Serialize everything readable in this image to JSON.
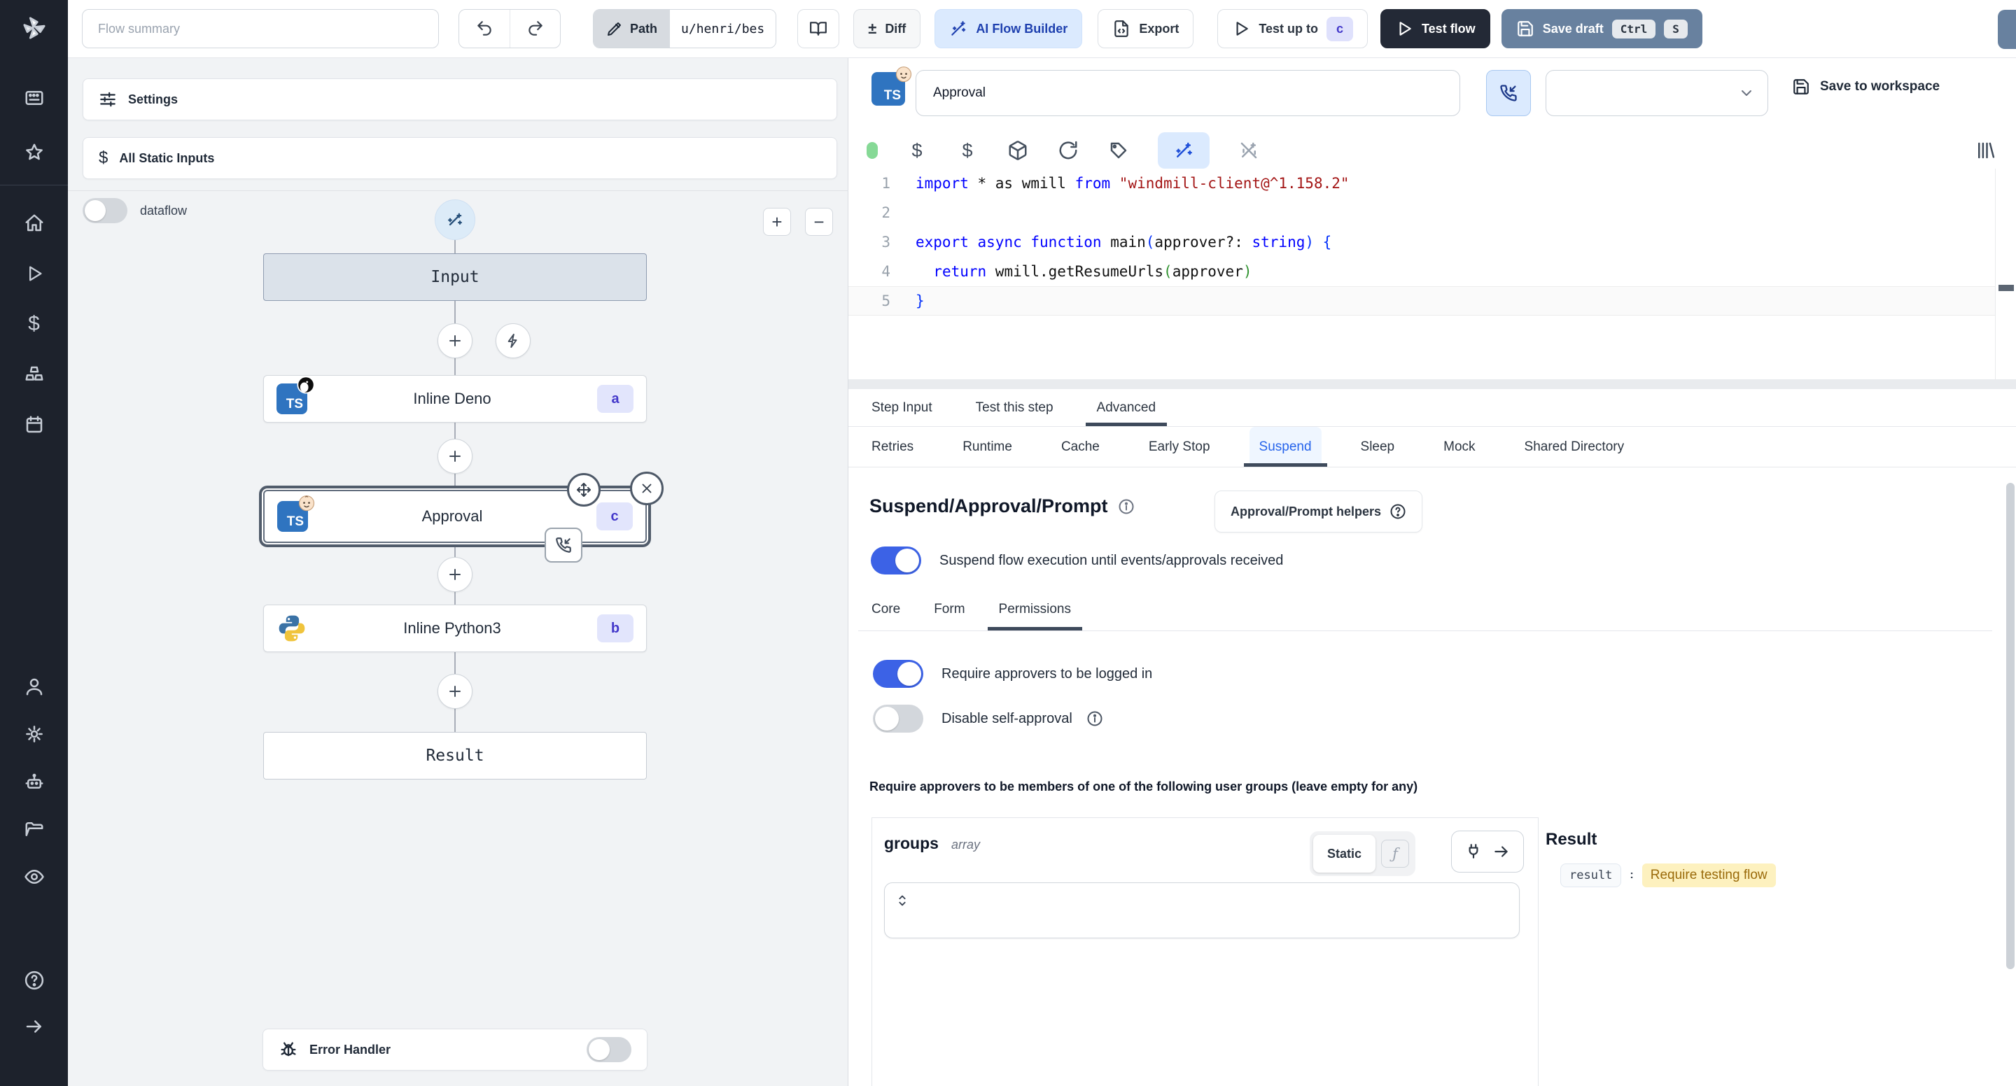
{
  "topbar": {
    "flow_summary_placeholder": "Flow summary",
    "path_label": "Path",
    "path_value": "u/henri/bes",
    "diff_label": "Diff",
    "ai_flow_builder_label": "AI Flow Builder",
    "export_label": "Export",
    "test_up_to_label": "Test up to",
    "test_up_to_badge": "c",
    "test_flow_label": "Test flow",
    "save_draft_label": "Save draft",
    "kbd_ctrl": "Ctrl",
    "kbd_s": "S"
  },
  "flow_panel": {
    "settings_label": "Settings",
    "all_static_inputs_label": "All Static Inputs",
    "dataflow_label": "dataflow",
    "error_handler_label": "Error Handler",
    "ts_chip": "TS",
    "nodes": {
      "input_label": "Input",
      "deno": {
        "label": "Inline Deno",
        "badge": "a"
      },
      "approval": {
        "label": "Approval",
        "badge": "c"
      },
      "python": {
        "label": "Inline Python3",
        "badge": "b"
      },
      "result_label": "Result"
    }
  },
  "editor": {
    "title_value": "Approval",
    "save_to_workspace_label": "Save to workspace",
    "code_lines": [
      {
        "n": "1",
        "toks": [
          [
            "kw",
            "import"
          ],
          [
            "pl",
            " * as wmill "
          ],
          [
            "kw",
            "from"
          ],
          [
            "str",
            " \"windmill-client@^1.158.2\""
          ]
        ],
        "current": false
      },
      {
        "n": "2",
        "toks": [],
        "current": false
      },
      {
        "n": "3",
        "toks": [
          [
            "kw",
            "export"
          ],
          [
            "pl",
            " "
          ],
          [
            "kw",
            "async"
          ],
          [
            "pl",
            " "
          ],
          [
            "kw",
            "function"
          ],
          [
            "pl",
            " main"
          ],
          [
            "b1",
            "("
          ],
          [
            "pl",
            "approver?: "
          ],
          [
            "kw",
            "string"
          ],
          [
            "b1",
            ")"
          ],
          [
            "pl",
            " "
          ],
          [
            "b1",
            "{"
          ]
        ],
        "current": false
      },
      {
        "n": "4",
        "toks": [
          [
            "pl",
            "  "
          ],
          [
            "kw",
            "return"
          ],
          [
            "pl",
            " wmill.getResumeUrls"
          ],
          [
            "b2",
            "("
          ],
          [
            "pl",
            "approver"
          ],
          [
            "b2",
            ")"
          ]
        ],
        "current": false
      },
      {
        "n": "5",
        "toks": [
          [
            "b1",
            "}"
          ]
        ],
        "current": true
      }
    ]
  },
  "tabs": {
    "step_input": "Step Input",
    "test_this_step": "Test this step",
    "advanced": "Advanced"
  },
  "advanced_tabs": [
    "Retries",
    "Runtime",
    "Cache",
    "Early Stop",
    "Suspend",
    "Sleep",
    "Mock",
    "Shared Directory"
  ],
  "suspend_section": {
    "heading": "Suspend/Approval/Prompt",
    "helpers_button_label": "Approval/Prompt helpers",
    "suspend_toggle_label": "Suspend flow execution until events/approvals received",
    "subtabs": [
      "Core",
      "Form",
      "Permissions"
    ],
    "require_login_label": "Require approvers to be logged in",
    "disable_self_approval_label": "Disable self-approval",
    "groups_note": "Require approvers to be members of one of the following user groups (leave empty for any)",
    "groups_label": "groups",
    "groups_type": "array",
    "static_label": "Static",
    "result_heading": "Result",
    "result_key": "result",
    "result_separator": ":",
    "result_value": "Require testing flow"
  },
  "glyphs": {
    "plus": "+",
    "minus": "−",
    "plus_minus": "±",
    "fn": "ƒ",
    "dollar": "$"
  },
  "colors": {
    "accent_blue": "#2563eb",
    "toggle_on": "#3c62e6",
    "ai_button_bg": "#dbeafe",
    "ai_button_text": "#1e40af",
    "badge_bg": "#e2e5fc",
    "badge_text": "#4338ca",
    "dark_button": "#232936",
    "save_draft_button": "#68819f",
    "sidebar_bg": "#1d222c",
    "canvas_bg": "#f1f3f5",
    "input_node_bg": "#dbe2ea",
    "code_keyword": "#0000ff",
    "code_string": "#a31515",
    "result_highlight_bg": "#fdf1bf",
    "result_highlight_text": "#9a6a0a",
    "status_dot": "#86d996"
  }
}
